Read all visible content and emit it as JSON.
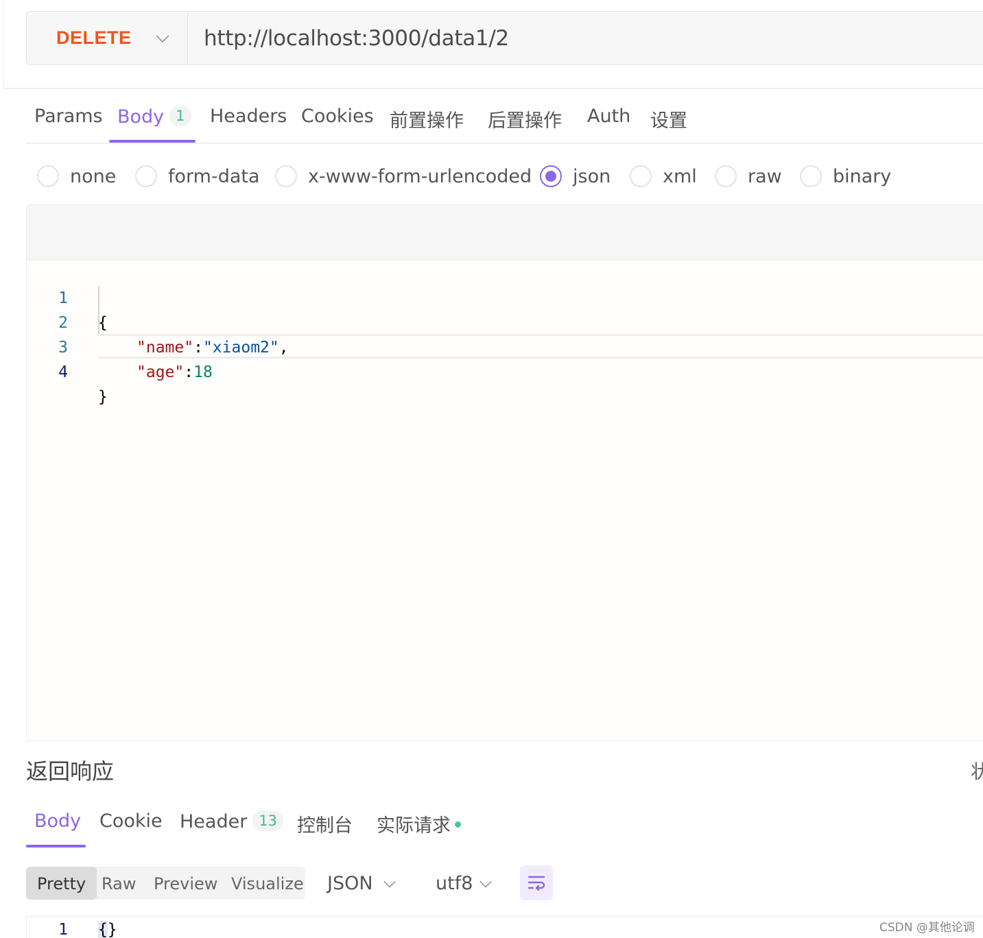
{
  "request": {
    "method": "DELETE",
    "url": "http://localhost:3000/data1/2"
  },
  "request_tabs": [
    {
      "label": "Params"
    },
    {
      "label": "Body",
      "badge": "1"
    },
    {
      "label": "Headers"
    },
    {
      "label": "Cookies"
    },
    {
      "label": "前置操作"
    },
    {
      "label": "后置操作"
    },
    {
      "label": "Auth"
    },
    {
      "label": "设置"
    }
  ],
  "body_types": [
    {
      "label": "none",
      "checked": false
    },
    {
      "label": "form-data",
      "checked": false
    },
    {
      "label": "x-www-form-urlencoded",
      "checked": false
    },
    {
      "label": "json",
      "checked": true
    },
    {
      "label": "xml",
      "checked": false
    },
    {
      "label": "raw",
      "checked": false
    },
    {
      "label": "binary",
      "checked": false
    }
  ],
  "editor": {
    "lines": [
      {
        "num": "1",
        "open": "{"
      },
      {
        "num": "2",
        "key": "\"name\"",
        "sep": ":",
        "value": "\"xiaom2\"",
        "trail": ","
      },
      {
        "num": "3",
        "key": "\"age\"",
        "sep": ":",
        "value": "18"
      },
      {
        "num": "4",
        "close": "}"
      }
    ]
  },
  "response": {
    "title": "返回响应",
    "right_text": "状",
    "tabs": [
      {
        "label": "Body"
      },
      {
        "label": "Cookie"
      },
      {
        "label": "Header",
        "badge": "13"
      },
      {
        "label": "控制台"
      },
      {
        "label": "实际请求"
      }
    ],
    "views": [
      "Pretty",
      "Raw",
      "Preview",
      "Visualize"
    ],
    "format": "JSON",
    "encoding": "utf8",
    "body_line_num": "1",
    "body_open": "{",
    "body_close": "}"
  },
  "watermark": "CSDN @其他论调",
  "colors": {
    "accent": "#8c66e6",
    "method": "#f0531f",
    "badge": "#3ebf8c"
  }
}
